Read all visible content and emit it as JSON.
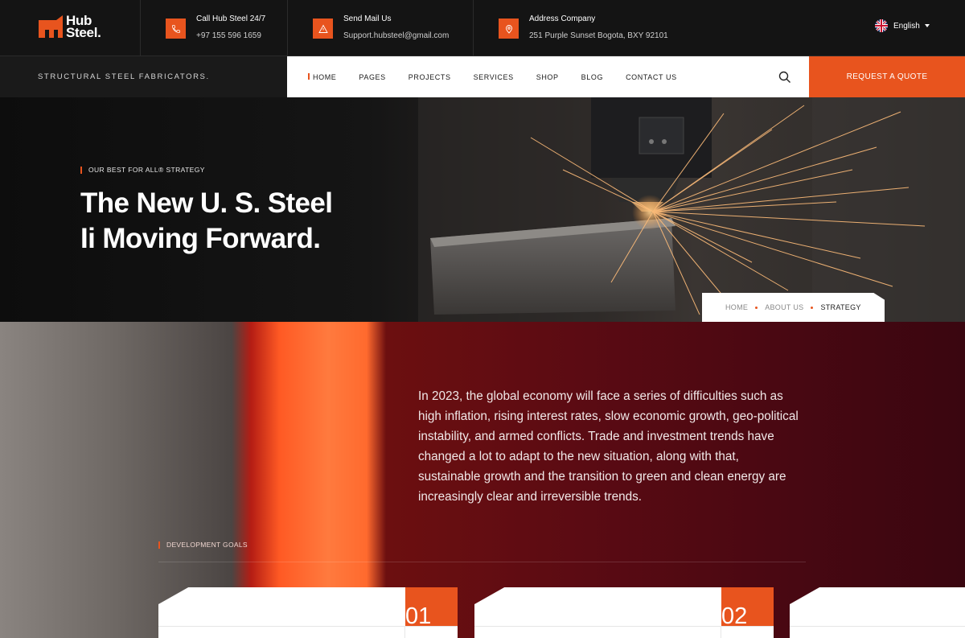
{
  "brand": {
    "line1": "Hub",
    "line2": "Steel.",
    "accent": "#e8541e"
  },
  "topbar": {
    "contacts": [
      {
        "icon": "phone-icon",
        "title": "Call Hub Steel 24/7",
        "value": "+97 155 596 1659"
      },
      {
        "icon": "mail-icon",
        "title": "Send Mail Us",
        "value": "Support.hubsteel@gmail.com"
      },
      {
        "icon": "location-pin-icon",
        "title": "Address Company",
        "value": "251 Purple Sunset Bogota, BXY 92101"
      }
    ],
    "language": "English"
  },
  "nav": {
    "tagline": "STRUCTURAL STEEL FABRICATORS.",
    "items": [
      "HOME",
      "PAGES",
      "PROJECTS",
      "SERVICES",
      "SHOP",
      "BLOG",
      "CONTACT US"
    ],
    "cta": "REQUEST A QUOTE"
  },
  "hero": {
    "eyebrow": "OUR BEST FOR ALL® STRATEGY",
    "title_line1": "The New U. S. Steel",
    "title_line2": "Ii Moving Forward."
  },
  "breadcrumb": [
    "HOME",
    "ABOUT US",
    "STRATEGY"
  ],
  "content": {
    "paragraph": "In 2023, the global economy will face a series of difficulties such as high inflation, rising interest rates, slow economic growth, geo-political instability, and armed conflicts. Trade and investment trends have changed a lot to adapt to the new situation, along with that, sustainable growth and the transition to green and clean energy are increasingly clear and irreversible trends.",
    "goals_label": "DEVELOPMENT GOALS",
    "cards": [
      "01",
      "02"
    ]
  }
}
